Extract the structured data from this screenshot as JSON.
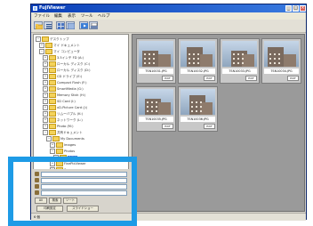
{
  "window": {
    "title": "FujiViewer",
    "buttons": [
      "_",
      "□",
      "×"
    ]
  },
  "menubar": {
    "items": [
      "ファイル",
      "編集",
      "表示",
      "ツール",
      "ヘルプ"
    ]
  },
  "toolbar": {
    "icons": [
      "folder-icon",
      "list-icon",
      "thumbs-icon",
      "grid-icon",
      "slideshow-icon",
      "print-icon"
    ]
  },
  "tree": {
    "items": [
      {
        "label": "デスクトップ",
        "indent": 0,
        "expanded": true
      },
      {
        "label": "マイ ドキュメント",
        "indent": 1
      },
      {
        "label": "マイ コンピュータ",
        "indent": 1,
        "expanded": true
      },
      {
        "label": "3.5インチ FD (A:)",
        "indent": 2
      },
      {
        "label": "ローカル ディスク (C:)",
        "indent": 2
      },
      {
        "label": "ローカル ディスク (D:)",
        "indent": 2
      },
      {
        "label": "CD ドライブ (E:)",
        "indent": 2
      },
      {
        "label": "Compact Flash (F:)",
        "indent": 2
      },
      {
        "label": "SmartMedia (G:)",
        "indent": 2
      },
      {
        "label": "Memory Stick (H:)",
        "indent": 2
      },
      {
        "label": "SD Card (I:)",
        "indent": 2
      },
      {
        "label": "xD-Picture Card (J:)",
        "indent": 2
      },
      {
        "label": "リムーバブル (K:)",
        "indent": 2
      },
      {
        "label": "ネットワーク (L:)",
        "indent": 2
      },
      {
        "label": "Photo (M:)",
        "indent": 2
      },
      {
        "label": "共有ドキュメント",
        "indent": 2,
        "expanded": true
      },
      {
        "label": "My Documents",
        "indent": 3,
        "expanded": true
      },
      {
        "label": "Images",
        "indent": 4
      },
      {
        "label": "Photos",
        "indent": 4,
        "expanded": true
      },
      {
        "label": "DCIM",
        "indent": 5,
        "selected": true
      },
      {
        "label": "FinePixViewer",
        "indent": 4
      },
      {
        "label": "Scans",
        "indent": 4
      },
      {
        "label": "My Albums",
        "indent": 4
      },
      {
        "label": "Music",
        "indent": 3
      }
    ]
  },
  "thumbnails": [
    {
      "filename": "TSN10031.JPG",
      "badge": "EXIF"
    },
    {
      "filename": "TSN10032.JPG",
      "badge": "EXIF"
    },
    {
      "filename": "TSN10033.JPG",
      "badge": "EXIF"
    },
    {
      "filename": "TSN10034.JPG",
      "badge": "EXIF"
    },
    {
      "filename": "TSN10035.JPG",
      "badge": "EXIF"
    },
    {
      "filename": "TSN10036.JPG",
      "badge": "EXIF"
    }
  ],
  "lower_panel": {
    "fields": [
      "",
      "",
      "",
      ""
    ],
    "small_labels": [
      "All",
      "検索",
      "ソート"
    ],
    "buttons": [
      "印刷設定",
      "スライドショー"
    ]
  },
  "status": {
    "text": "6 個"
  }
}
